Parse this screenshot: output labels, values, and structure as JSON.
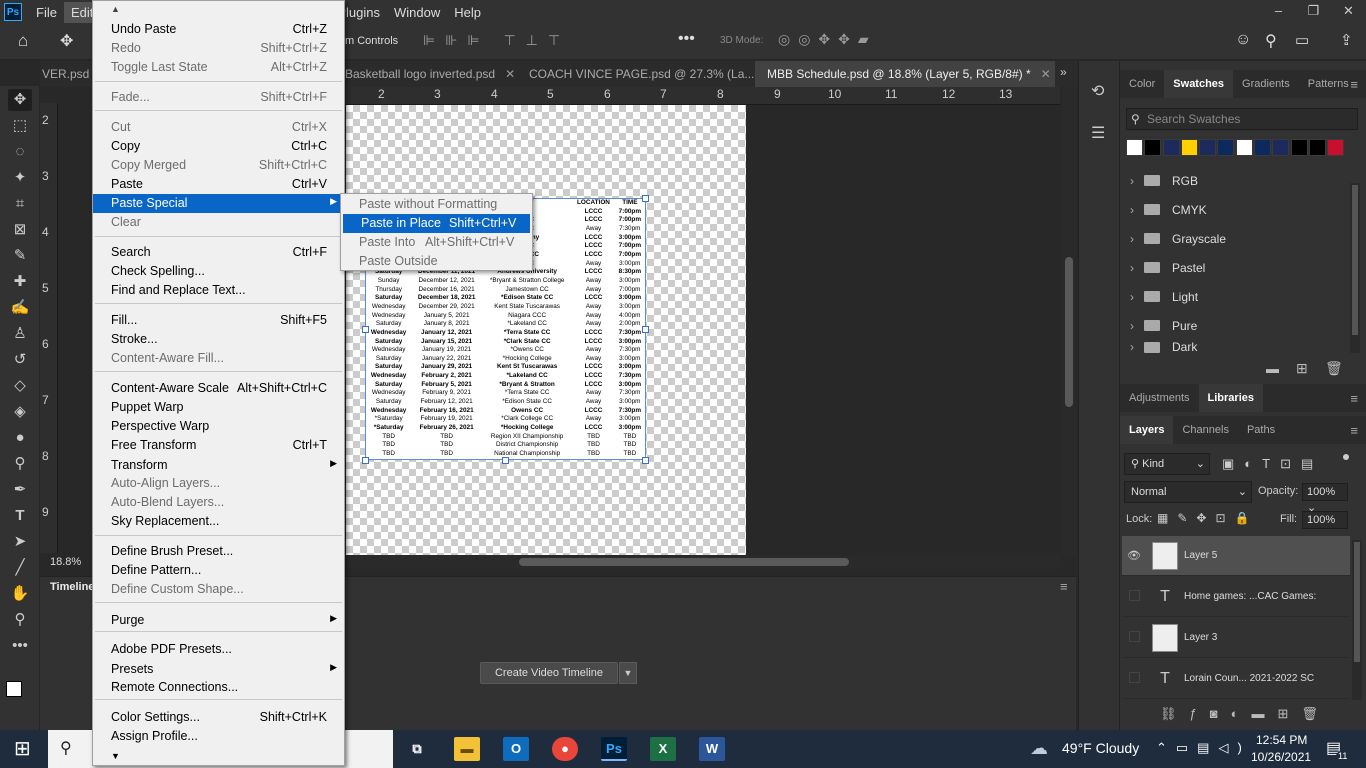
{
  "app": {
    "logo": "Ps"
  },
  "menubar": {
    "items": [
      "File",
      "Edit",
      "Plugins",
      "Window",
      "Help"
    ]
  },
  "window_controls": [
    "–",
    "❐",
    "✕"
  ],
  "options_bar": {
    "transform_controls_label": "m Controls",
    "mode_3d": "3D Mode:"
  },
  "doc_tabs": [
    {
      "label": "VER.psd @",
      "active": false
    },
    {
      "label": "Basketball logo inverted.psd",
      "active": false
    },
    {
      "label": "COACH VINCE PAGE.psd @ 27.3% (La...",
      "active": false
    },
    {
      "label": "MBB Schedule.psd @ 18.8% (Layer 5, RGB/8#) *",
      "active": true
    }
  ],
  "ruler_h": [
    "2",
    "3",
    "4",
    "5",
    "6",
    "7",
    "8",
    "9",
    "10",
    "11",
    "12",
    "13"
  ],
  "ruler_v": [
    "2",
    "3",
    "4",
    "5",
    "6",
    "7",
    "8",
    "9"
  ],
  "zoom": "18.8%",
  "schedule": {
    "header": [
      "",
      "",
      "ENT",
      "LOCATION",
      "TIME"
    ],
    "rows": [
      [
        "",
        "",
        "(JV)",
        "LCCC",
        "7:00pm",
        true
      ],
      [
        "",
        "",
        "CCC",
        "LCCC",
        "7:00pm",
        true
      ],
      [
        "",
        "",
        "CCC",
        "Away",
        "7:30pm",
        false
      ],
      [
        "",
        "",
        "legheny",
        "LCCC",
        "3:00pm",
        true
      ],
      [
        "",
        "",
        "CCC",
        "LCCC",
        "7:00pm",
        true
      ],
      [
        "",
        "",
        "own CC",
        "LCCC",
        "7:00pm",
        true
      ],
      [
        "",
        "",
        "CCC",
        "Away",
        "3:00pm",
        false
      ],
      [
        "Saturday",
        "December 11, 2021",
        "Andrews University",
        "LCCC",
        "8:30pm",
        true
      ],
      [
        "Sunday",
        "December 12, 2021",
        "*Bryant & Stratton College",
        "Away",
        "3:00pm",
        false
      ],
      [
        "Thursday",
        "December 16, 2021",
        "Jamestown CC",
        "Away",
        "7:00pm",
        false
      ],
      [
        "Saturday",
        "December 18, 2021",
        "*Edison State CC",
        "LCCC",
        "3:00pm",
        true
      ],
      [
        "Wednesday",
        "December 29, 2021",
        "Kent State Tuscarawas",
        "Away",
        "3:00pm",
        false
      ],
      [
        "Wednesday",
        "January 5, 2021",
        "Niagara CCC",
        "Away",
        "4:00pm",
        false
      ],
      [
        "Saturday",
        "January 8, 2021",
        "*Lakeland CC",
        "Away",
        "2:00pm",
        false
      ],
      [
        "Wednesday",
        "January 12, 2021",
        "*Terra State CC",
        "LCCC",
        "7:30pm",
        true
      ],
      [
        "Saturday",
        "January 15, 2021",
        "*Clark State CC",
        "LCCC",
        "3:00pm",
        true
      ],
      [
        "Wednesday",
        "January 19, 2021",
        "*Owens CC",
        "Away",
        "7:30pm",
        false
      ],
      [
        "Saturday",
        "January 22, 2021",
        "*Hocking College",
        "Away",
        "3:00pm",
        false
      ],
      [
        "Saturday",
        "January 29, 2021",
        "Kent St Tuscarawas",
        "LCCC",
        "3:00pm",
        true
      ],
      [
        "Wednesday",
        "February 2, 2021",
        "*Lakeland CC",
        "LCCC",
        "7:30pm",
        true
      ],
      [
        "Saturday",
        "February 5, 2021",
        "*Bryant & Stratton",
        "LCCC",
        "3:00pm",
        true
      ],
      [
        "Wednesday",
        "February 9, 2021",
        "*Terra State CC",
        "Away",
        "7:30pm",
        false
      ],
      [
        "Saturday",
        "February 12, 2021",
        "*Edison State CC",
        "Away",
        "3:00pm",
        false
      ],
      [
        "Wednesday",
        "February 16, 2021",
        "Owens CC",
        "LCCC",
        "7:30pm",
        true
      ],
      [
        "*Saturday",
        "February 19, 2021",
        "*Clark College CC",
        "Away",
        "3:00pm",
        false
      ],
      [
        "*Saturday",
        "February 26, 2021",
        "*Hocking College",
        "LCCC",
        "3:00pm",
        true
      ],
      [
        "TBD",
        "TBD",
        "Region XII Championship",
        "TBD",
        "TBD",
        false
      ],
      [
        "TBD",
        "TBD",
        "District Championship",
        "TBD",
        "TBD",
        false
      ],
      [
        "TBD",
        "TBD",
        "National Championship",
        "TBD",
        "TBD",
        false
      ]
    ]
  },
  "timeline": {
    "title": "Timeline",
    "create_button": "Create Video Timeline"
  },
  "swatches_panel": {
    "tabs": [
      "Color",
      "Swatches",
      "Gradients",
      "Patterns"
    ],
    "search_placeholder": "Search Swatches",
    "colors": [
      "#ffffff",
      "#000000",
      "#1c2a5c",
      "#ffd100",
      "#1c2a5c",
      "#0c2a5e",
      "#ffffff",
      "#0c2a5e",
      "#1c2a5c",
      "#000000",
      "#000000",
      "#c8102e"
    ],
    "folders": [
      "RGB",
      "CMYK",
      "Grayscale",
      "Pastel",
      "Light",
      "Pure",
      "Dark"
    ]
  },
  "adj_tabs": [
    "Adjustments",
    "Libraries"
  ],
  "layers_panel": {
    "tabs": [
      "Layers",
      "Channels",
      "Paths"
    ],
    "kind": "Kind",
    "blend": "Normal",
    "opacity_label": "Opacity:",
    "opacity": "100%",
    "lock_label": "Lock:",
    "fill_label": "Fill:",
    "fill": "100%",
    "layers": [
      {
        "name": "Layer 5",
        "type": "image",
        "visible": true,
        "selected": true
      },
      {
        "name": "Home games: ...CAC Games:",
        "type": "text",
        "visible": false,
        "selected": false
      },
      {
        "name": "Layer 3",
        "type": "image",
        "visible": false,
        "selected": false
      },
      {
        "name": "Lorain Coun... 2021-2022 SC",
        "type": "text",
        "visible": false,
        "selected": false
      }
    ]
  },
  "edit_menu": {
    "items": [
      {
        "label": "Undo Paste",
        "shortcut": "Ctrl+Z",
        "disabled": false
      },
      {
        "label": "Redo",
        "shortcut": "Shift+Ctrl+Z",
        "disabled": true
      },
      {
        "label": "Toggle Last State",
        "shortcut": "Alt+Ctrl+Z",
        "disabled": true
      },
      {
        "sep": true
      },
      {
        "label": "Fade...",
        "shortcut": "Shift+Ctrl+F",
        "disabled": true
      },
      {
        "sep": true
      },
      {
        "label": "Cut",
        "shortcut": "Ctrl+X",
        "disabled": true
      },
      {
        "label": "Copy",
        "shortcut": "Ctrl+C",
        "disabled": false
      },
      {
        "label": "Copy Merged",
        "shortcut": "Shift+Ctrl+C",
        "disabled": true
      },
      {
        "label": "Paste",
        "shortcut": "Ctrl+V",
        "disabled": false
      },
      {
        "label": "Paste Special",
        "shortcut": "",
        "disabled": false,
        "submenu": true,
        "highlighted": true
      },
      {
        "label": "Clear",
        "shortcut": "",
        "disabled": true
      },
      {
        "sep": true
      },
      {
        "label": "Search",
        "shortcut": "Ctrl+F",
        "disabled": false
      },
      {
        "label": "Check Spelling...",
        "shortcut": "",
        "disabled": false
      },
      {
        "label": "Find and Replace Text...",
        "shortcut": "",
        "disabled": false
      },
      {
        "sep": true
      },
      {
        "label": "Fill...",
        "shortcut": "Shift+F5",
        "disabled": false
      },
      {
        "label": "Stroke...",
        "shortcut": "",
        "disabled": false
      },
      {
        "label": "Content-Aware Fill...",
        "shortcut": "",
        "disabled": true
      },
      {
        "sep": true
      },
      {
        "label": "Content-Aware Scale",
        "shortcut": "Alt+Shift+Ctrl+C",
        "disabled": false
      },
      {
        "label": "Puppet Warp",
        "shortcut": "",
        "disabled": false
      },
      {
        "label": "Perspective Warp",
        "shortcut": "",
        "disabled": false
      },
      {
        "label": "Free Transform",
        "shortcut": "Ctrl+T",
        "disabled": false
      },
      {
        "label": "Transform",
        "shortcut": "",
        "disabled": false,
        "submenu": true
      },
      {
        "label": "Auto-Align Layers...",
        "shortcut": "",
        "disabled": true
      },
      {
        "label": "Auto-Blend Layers...",
        "shortcut": "",
        "disabled": true
      },
      {
        "label": "Sky Replacement...",
        "shortcut": "",
        "disabled": false
      },
      {
        "sep": true
      },
      {
        "label": "Define Brush Preset...",
        "shortcut": "",
        "disabled": false
      },
      {
        "label": "Define Pattern...",
        "shortcut": "",
        "disabled": false
      },
      {
        "label": "Define Custom Shape...",
        "shortcut": "",
        "disabled": true
      },
      {
        "sep": true
      },
      {
        "label": "Purge",
        "shortcut": "",
        "disabled": false,
        "submenu": true
      },
      {
        "sep": true
      },
      {
        "label": "Adobe PDF Presets...",
        "shortcut": "",
        "disabled": false
      },
      {
        "label": "Presets",
        "shortcut": "",
        "disabled": false,
        "submenu": true
      },
      {
        "label": "Remote Connections...",
        "shortcut": "",
        "disabled": false
      },
      {
        "sep": true
      },
      {
        "label": "Color Settings...",
        "shortcut": "Shift+Ctrl+K",
        "disabled": false
      },
      {
        "label": "Assign Profile...",
        "shortcut": "",
        "disabled": false
      }
    ]
  },
  "paste_special_menu": [
    {
      "label": "Paste without Formatting",
      "shortcut": "",
      "disabled": true
    },
    {
      "label": "Paste in Place",
      "shortcut": "Shift+Ctrl+V",
      "disabled": false,
      "highlighted": true
    },
    {
      "label": "Paste Into",
      "shortcut": "Alt+Shift+Ctrl+V",
      "disabled": true
    },
    {
      "label": "Paste Outside",
      "shortcut": "",
      "disabled": true
    }
  ],
  "taskbar": {
    "weather": "49°F  Cloudy",
    "time": "12:54 PM",
    "date": "10/26/2021",
    "notif_count": "11",
    "apps": [
      "task-view",
      "file-explorer",
      "outlook",
      "chrome",
      "photoshop",
      "excel",
      "word"
    ]
  }
}
